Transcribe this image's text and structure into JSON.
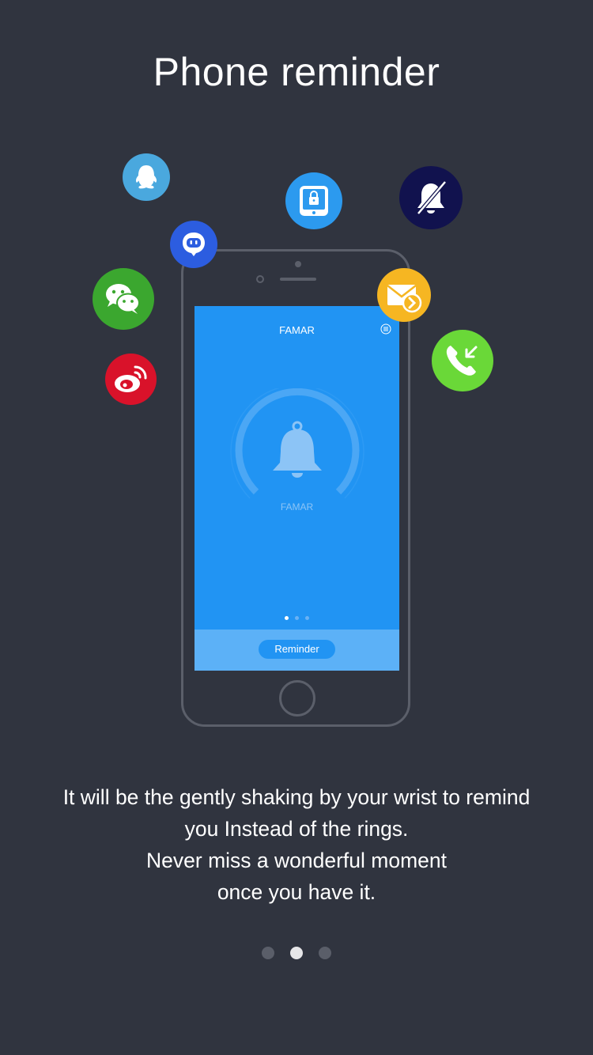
{
  "title": "Phone reminder",
  "phone": {
    "app_title": "FAMAR",
    "gauge_label": "FAMAR",
    "reminder_button": "Reminder",
    "page_indicator": {
      "count": 3,
      "active": 0
    }
  },
  "icons": [
    {
      "name": "qq-icon",
      "color": "#4aa8de"
    },
    {
      "name": "tablet-lock-icon",
      "color": "#2c9aef"
    },
    {
      "name": "notification-off-icon",
      "color": "#11124e"
    },
    {
      "name": "messenger-icon",
      "color": "#2c5de0"
    },
    {
      "name": "wechat-icon",
      "color": "#3ba72f"
    },
    {
      "name": "mail-forward-icon",
      "color": "#f6b622"
    },
    {
      "name": "weibo-icon",
      "color": "#d9122a"
    },
    {
      "name": "incoming-call-icon",
      "color": "#6ad838"
    }
  ],
  "description": {
    "line1": "It will be the gently shaking by your wrist to remind",
    "line2": "you Instead of the rings.",
    "line3": "Never miss a wonderful moment",
    "line4": "once you have it."
  },
  "pager": {
    "count": 3,
    "active": 1
  },
  "colors": {
    "background": "#30343f",
    "screen": "#2194f3",
    "bottom_bar": "#5cb1f7"
  }
}
